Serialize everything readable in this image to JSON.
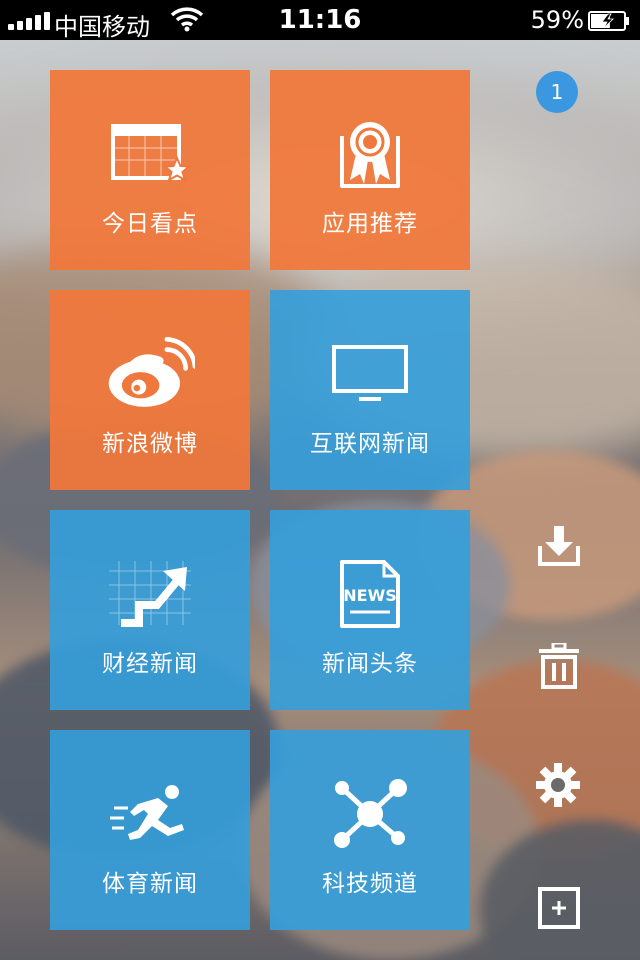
{
  "status_bar": {
    "carrier": "中国移动",
    "time": "11:16",
    "battery_percent": "59%",
    "battery_level": 0.59,
    "signal_bars": 5
  },
  "notification_badge": "1",
  "tiles": [
    {
      "label": "今日看点",
      "icon": "calendar-star-icon",
      "color": "#f0783c"
    },
    {
      "label": "应用推荐",
      "icon": "award-ribbon-icon",
      "color": "#f0783c"
    },
    {
      "label": "新浪微博",
      "icon": "weibo-icon",
      "color": "#f0783c"
    },
    {
      "label": "互联网新闻",
      "icon": "monitor-icon",
      "color": "#349edc"
    },
    {
      "label": "财经新闻",
      "icon": "trend-arrow-icon",
      "color": "#349edc"
    },
    {
      "label": "新闻头条",
      "icon": "news-page-icon",
      "color": "#349edc"
    },
    {
      "label": "体育新闻",
      "icon": "runner-icon",
      "color": "#349edc"
    },
    {
      "label": "科技频道",
      "icon": "network-nodes-icon",
      "color": "#349edc"
    }
  ],
  "news_icon_text": "NEWS",
  "side_actions": [
    {
      "icon": "download-icon"
    },
    {
      "icon": "trash-icon"
    },
    {
      "icon": "settings-gear-icon"
    },
    {
      "icon": "add-icon"
    }
  ]
}
